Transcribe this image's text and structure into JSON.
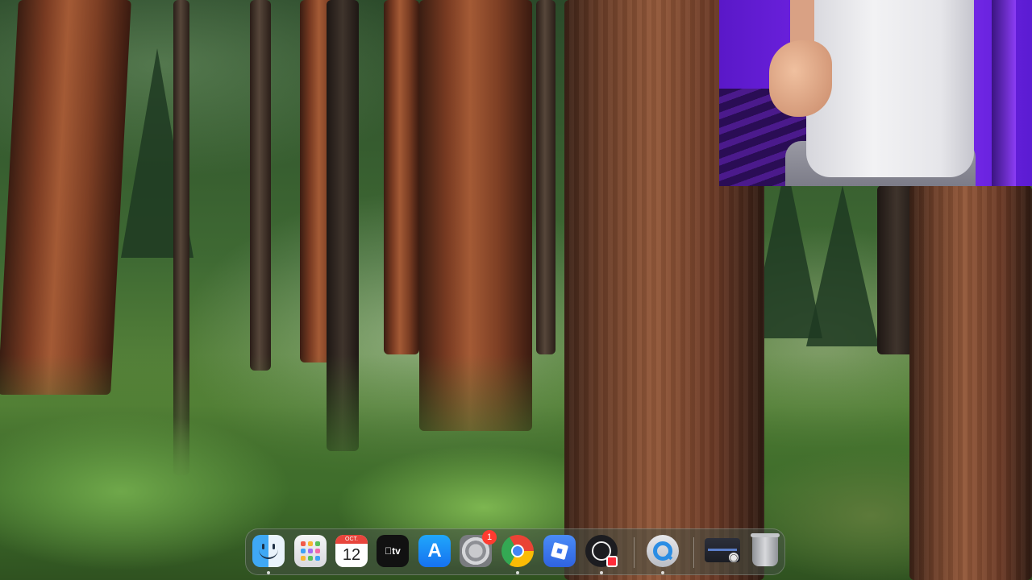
{
  "dock": {
    "items": [
      {
        "name": "Finder",
        "icon": "finder-icon",
        "running": true
      },
      {
        "name": "Launchpad",
        "icon": "launchpad-icon",
        "running": false
      },
      {
        "name": "Calendar",
        "icon": "calendar-icon",
        "month": "OCT.",
        "day": "12",
        "running": false
      },
      {
        "name": "TV",
        "icon": "apple-tv-icon",
        "label": "tv",
        "running": false
      },
      {
        "name": "App Store",
        "icon": "app-store-icon",
        "running": false
      },
      {
        "name": "System Settings",
        "icon": "gear-icon",
        "badge": "1",
        "running": false
      },
      {
        "name": "Google Chrome",
        "icon": "chrome-icon",
        "running": true
      },
      {
        "name": "Roblox",
        "icon": "roblox-icon",
        "running": false
      },
      {
        "name": "OBS",
        "icon": "obs-icon",
        "running": true
      },
      {
        "name": "QuickTime Player",
        "icon": "quicktime-icon",
        "running": true
      },
      {
        "name": "Minimized Window",
        "icon": "window-thumbnail-icon",
        "running": false
      },
      {
        "name": "Trash",
        "icon": "trash-icon",
        "running": false
      }
    ]
  },
  "colors": {
    "badge": "#ff3b30",
    "calendar_month": "#e8453c",
    "webcam_backdrop": "#6d22e0"
  }
}
